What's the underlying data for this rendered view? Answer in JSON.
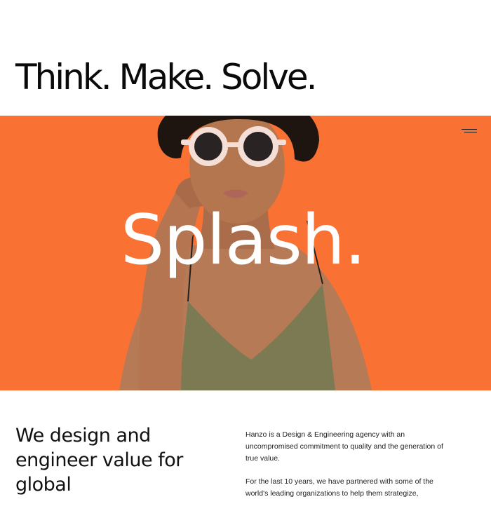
{
  "header": {
    "headline": "Think. Make. Solve."
  },
  "hero": {
    "splash_text": "Splash.",
    "background_color": "#fa7134",
    "image_description_icon": "model-portrait",
    "menu_icon": "menu-icon"
  },
  "intro": {
    "heading": "We design and engineer value for global",
    "paragraphs": [
      "Hanzo is a Design & Engineering agency with an uncompromised commitment to quality and the generation of true value.",
      "For the last 10 years, we have partnered with some of the world's leading organizations to help them strategize,"
    ]
  }
}
